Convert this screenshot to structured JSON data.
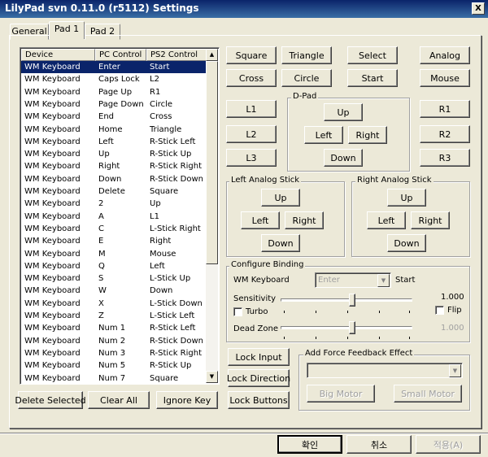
{
  "window": {
    "title": "LilyPad svn 0.11.0 (r5112) Settings",
    "close_glyph": "X"
  },
  "tabs": [
    {
      "label": "General"
    },
    {
      "label": "Pad 1"
    },
    {
      "label": "Pad 2"
    }
  ],
  "binding_list": {
    "columns": [
      "Device",
      "PC Control",
      "PS2 Control"
    ],
    "rows": [
      [
        "WM Keyboard",
        "Enter",
        "Start"
      ],
      [
        "WM Keyboard",
        "Caps Lock",
        "L2"
      ],
      [
        "WM Keyboard",
        "Page Up",
        "R1"
      ],
      [
        "WM Keyboard",
        "Page Down",
        "Circle"
      ],
      [
        "WM Keyboard",
        "End",
        "Cross"
      ],
      [
        "WM Keyboard",
        "Home",
        "Triangle"
      ],
      [
        "WM Keyboard",
        "Left",
        "R-Stick Left"
      ],
      [
        "WM Keyboard",
        "Up",
        "R-Stick Up"
      ],
      [
        "WM Keyboard",
        "Right",
        "R-Stick Right"
      ],
      [
        "WM Keyboard",
        "Down",
        "R-Stick Down"
      ],
      [
        "WM Keyboard",
        "Delete",
        "Square"
      ],
      [
        "WM Keyboard",
        "2",
        "Up"
      ],
      [
        "WM Keyboard",
        "A",
        "L1"
      ],
      [
        "WM Keyboard",
        "C",
        "L-Stick Right"
      ],
      [
        "WM Keyboard",
        "E",
        "Right"
      ],
      [
        "WM Keyboard",
        "M",
        "Mouse"
      ],
      [
        "WM Keyboard",
        "Q",
        "Left"
      ],
      [
        "WM Keyboard",
        "S",
        "L-Stick Up"
      ],
      [
        "WM Keyboard",
        "W",
        "Down"
      ],
      [
        "WM Keyboard",
        "X",
        "L-Stick Down"
      ],
      [
        "WM Keyboard",
        "Z",
        "L-Stick Left"
      ],
      [
        "WM Keyboard",
        "Num 1",
        "R-Stick Left"
      ],
      [
        "WM Keyboard",
        "Num 2",
        "R-Stick Down"
      ],
      [
        "WM Keyboard",
        "Num 3",
        "R-Stick Right"
      ],
      [
        "WM Keyboard",
        "Num 5",
        "R-Stick Up"
      ],
      [
        "WM Keyboard",
        "Num 7",
        "Square"
      ]
    ],
    "selected_row": 0,
    "scroll_up_glyph": "▲",
    "scroll_down_glyph": "▼"
  },
  "list_buttons": {
    "delete": "Delete Selected",
    "clear": "Clear All",
    "ignore": "Ignore Key"
  },
  "face_buttons": {
    "square": "Square",
    "triangle": "Triangle",
    "select": "Select",
    "analog": "Analog",
    "cross": "Cross",
    "circle": "Circle",
    "start": "Start",
    "mouse": "Mouse"
  },
  "shoulder_buttons": {
    "l1": "L1",
    "l2": "L2",
    "l3": "L3",
    "r1": "R1",
    "r2": "R2",
    "r3": "R3"
  },
  "dpad": {
    "title": "D-Pad",
    "up": "Up",
    "left": "Left",
    "right": "Right",
    "down": "Down"
  },
  "left_stick": {
    "title": "Left Analog Stick",
    "up": "Up",
    "left": "Left",
    "right": "Right",
    "down": "Down"
  },
  "right_stick": {
    "title": "Right Analog Stick",
    "up": "Up",
    "left": "Left",
    "right": "Right",
    "down": "Down"
  },
  "configure": {
    "title": "Configure Binding",
    "device": "WM Keyboard",
    "key_value": "Enter",
    "dropdown_glyph": "▼",
    "target": "Start",
    "sensitivity_label": "Sensitivity",
    "sensitivity_value": "1.000",
    "sensitivity_level": 0.55,
    "turbo_label": "Turbo",
    "turbo_checked": false,
    "flip_label": "Flip",
    "flip_checked": false,
    "deadzone_label": "Dead Zone",
    "deadzone_value": "1.000",
    "deadzone_level": 0.55
  },
  "lock_buttons": {
    "input": "Lock Input",
    "direction": "Lock Direction",
    "buttons": "Lock Buttons"
  },
  "force_feedback": {
    "title": "Add Force Feedback Effect",
    "dropdown_glyph": "▼",
    "big_motor": "Big Motor",
    "small_motor": "Small Motor"
  },
  "footer": {
    "ok": "확인",
    "cancel": "취소",
    "apply": "적용(A)"
  }
}
